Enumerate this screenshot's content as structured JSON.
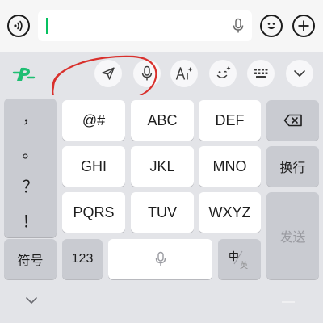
{
  "colors": {
    "accent": "#07c160",
    "annotation": "#d9302c",
    "key_bg": "#ffffff",
    "function_key_bg": "#c9cbd1",
    "keyboard_bg": "#e3e4e8"
  },
  "topbar": {
    "icons": [
      "voice-input-icon",
      "emoji-icon",
      "plus-icon",
      "microphone-icon"
    ],
    "input_value": ""
  },
  "toolbar": {
    "icons": [
      "input-method-logo-icon",
      "send-arrow-icon",
      "microphone-icon",
      "ai-writing-icon",
      "sticker-face-icon",
      "keyboard-switch-icon",
      "chevron-down-icon"
    ]
  },
  "keypad": {
    "punctuation": [
      "，",
      "。",
      "？",
      "！"
    ],
    "row1": [
      "@#",
      "ABC",
      "DEF"
    ],
    "row2": [
      "GHI",
      "JKL",
      "MNO"
    ],
    "row3": [
      "PQRS",
      "TUV",
      "WXYZ"
    ],
    "enter": "换行",
    "send": "发送",
    "symbols": "符号",
    "numbers": "123",
    "lang_zh": "中",
    "lang_en": "英"
  }
}
